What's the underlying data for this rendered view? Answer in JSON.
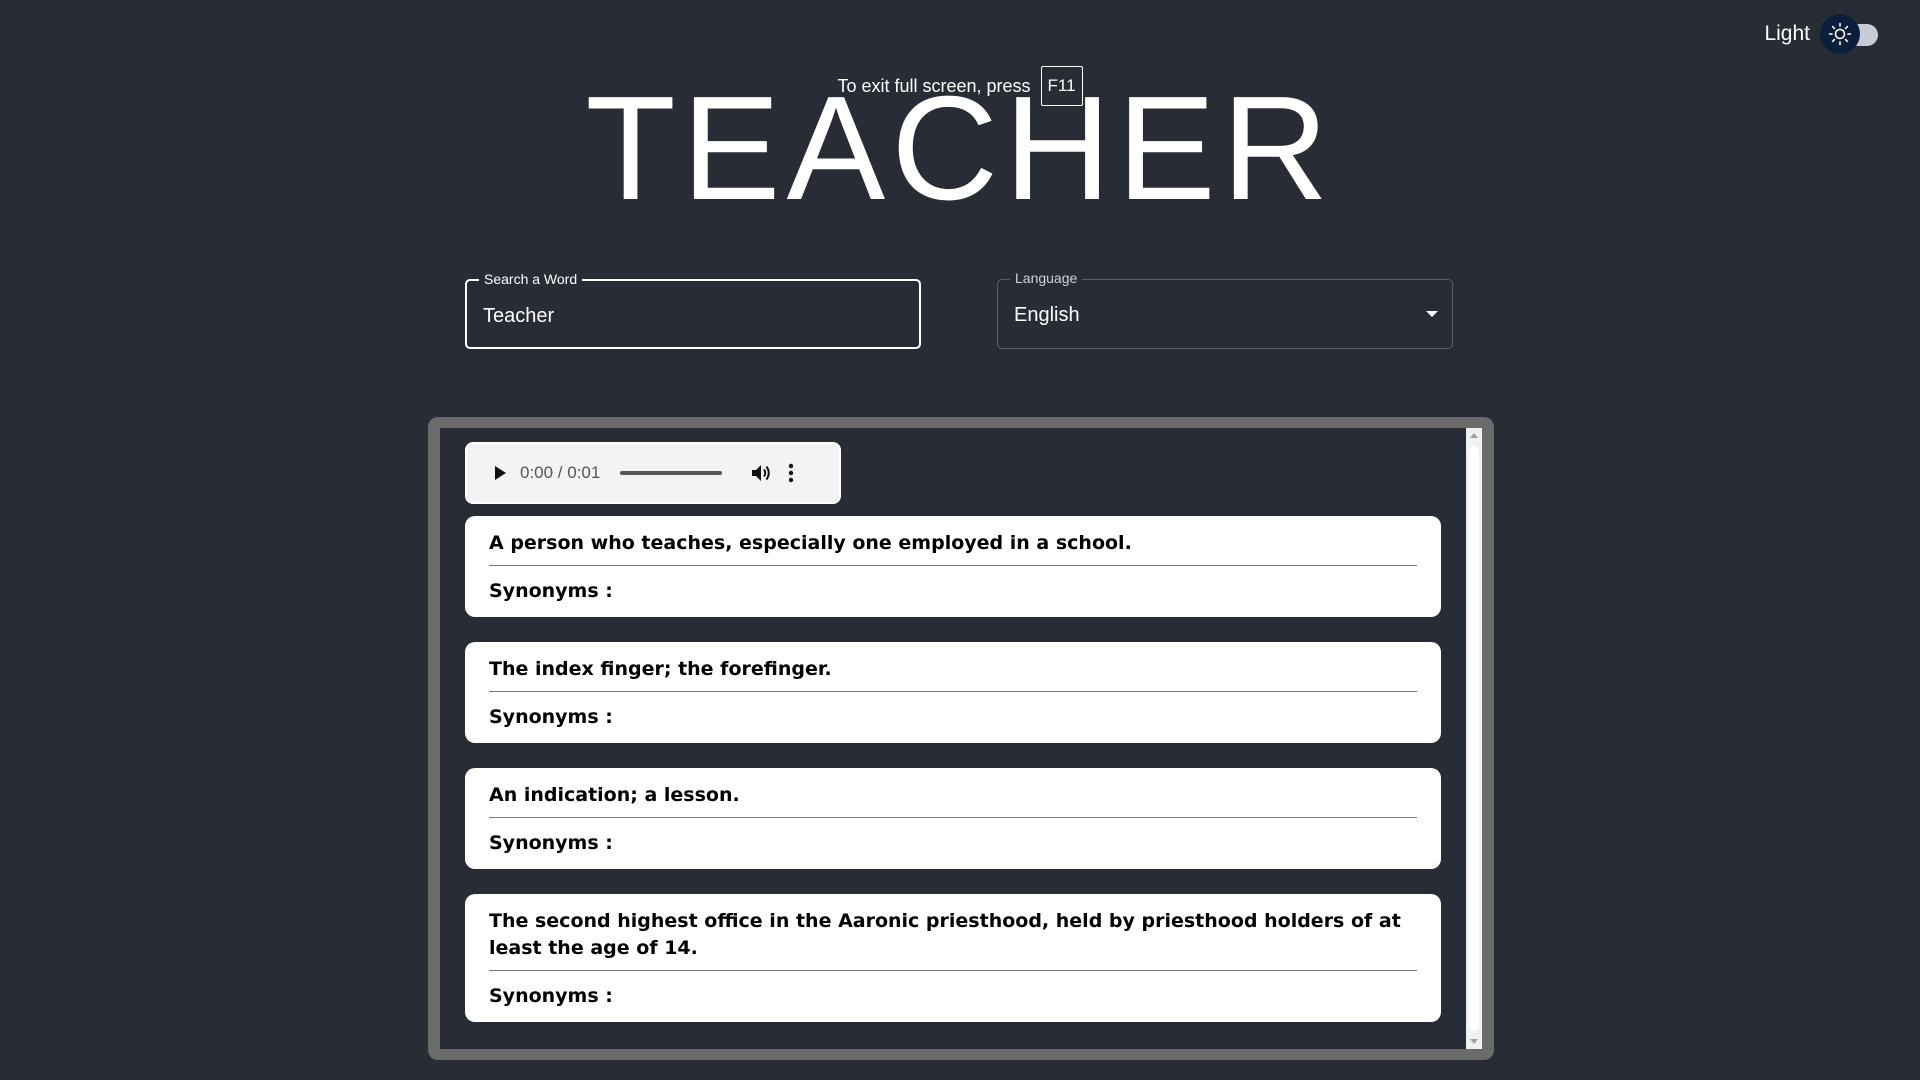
{
  "theme_toggle": {
    "label": "Light",
    "icon": "sun-icon"
  },
  "fullscreen_notice": {
    "text": "To exit full screen, press",
    "key": "F11"
  },
  "title": "TEACHER",
  "search": {
    "label": "Search a Word",
    "value": "Teacher"
  },
  "language": {
    "label": "Language",
    "selected": "English"
  },
  "audio": {
    "time": "0:00 / 0:01",
    "icons": [
      "play-icon",
      "volume-icon",
      "more-vert-icon"
    ]
  },
  "meanings": [
    {
      "definition": "A person who teaches, especially one employed in a school.",
      "synonyms_label": "Synonyms :"
    },
    {
      "definition": "The index finger; the forefinger.",
      "synonyms_label": "Synonyms :"
    },
    {
      "definition": "An indication; a lesson.",
      "synonyms_label": "Synonyms :"
    },
    {
      "definition": "The second highest office in the Aaronic priesthood, held by priesthood holders of at least the age of 14.",
      "synonyms_label": "Synonyms :"
    }
  ]
}
